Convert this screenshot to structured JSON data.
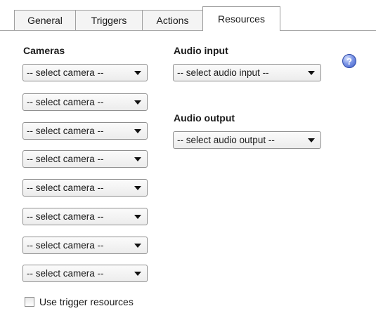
{
  "tabs": [
    {
      "label": "General"
    },
    {
      "label": "Triggers"
    },
    {
      "label": "Actions"
    },
    {
      "label": "Resources"
    }
  ],
  "active_tab": "Resources",
  "cameras": {
    "title": "Cameras",
    "selects": [
      {
        "value": "-- select camera --"
      },
      {
        "value": "-- select camera --"
      },
      {
        "value": "-- select camera --"
      },
      {
        "value": "-- select camera --"
      },
      {
        "value": "-- select camera --"
      },
      {
        "value": "-- select camera --"
      },
      {
        "value": "-- select camera --"
      },
      {
        "value": "-- select camera --"
      }
    ]
  },
  "audio_input": {
    "title": "Audio input",
    "value": "-- select audio input --"
  },
  "audio_output": {
    "title": "Audio output",
    "value": "-- select audio output --"
  },
  "help_icon": {
    "glyph": "?",
    "icon": "help-icon"
  },
  "use_trigger_resources": {
    "label": "Use trigger resources",
    "checked": false
  }
}
